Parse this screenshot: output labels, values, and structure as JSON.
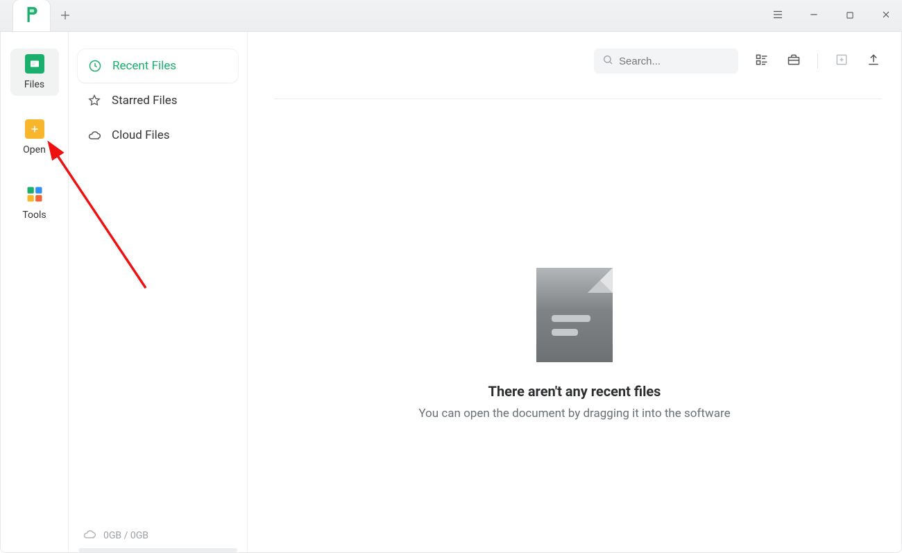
{
  "rail": {
    "items": [
      {
        "label": "Files"
      },
      {
        "label": "Open"
      },
      {
        "label": "Tools"
      }
    ]
  },
  "sidebar": {
    "items": [
      {
        "label": "Recent Files"
      },
      {
        "label": "Starred Files"
      },
      {
        "label": "Cloud Files"
      }
    ],
    "storage": "0GB / 0GB"
  },
  "toolbar": {
    "search_placeholder": "Search..."
  },
  "empty": {
    "title": "There aren't any recent files",
    "subtitle": "You can open the document by dragging it into the software"
  }
}
